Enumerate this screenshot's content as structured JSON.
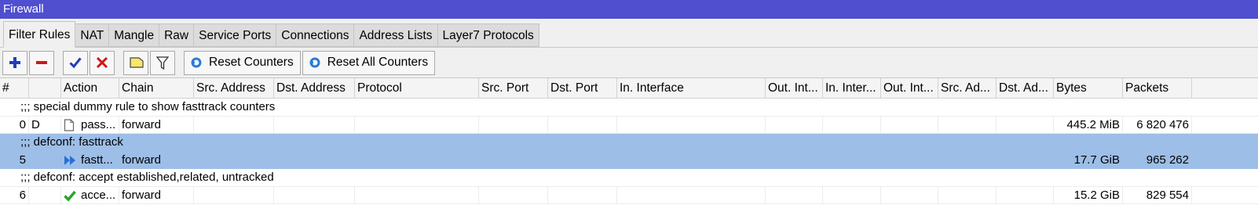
{
  "window": {
    "title": "Firewall"
  },
  "tabs": [
    {
      "label": "Filter Rules",
      "active": true
    },
    {
      "label": "NAT"
    },
    {
      "label": "Mangle"
    },
    {
      "label": "Raw"
    },
    {
      "label": "Service Ports"
    },
    {
      "label": "Connections"
    },
    {
      "label": "Address Lists"
    },
    {
      "label": "Layer7 Protocols"
    }
  ],
  "toolbar": {
    "add_icon": "plus-icon",
    "remove_icon": "minus-icon",
    "enable_icon": "check-icon",
    "disable_icon": "x-icon",
    "comment_icon": "note-icon",
    "filter_icon": "funnel-icon",
    "reset_counters_label": "Reset Counters",
    "reset_all_counters_label": "Reset All Counters"
  },
  "columns": [
    "#",
    "",
    "Action",
    "Chain",
    "Src. Address",
    "Dst. Address",
    "Protocol",
    "Src. Port",
    "Dst. Port",
    "In. Interface",
    "Out. Int...",
    "In. Inter...",
    "Out. Int...",
    "Src. Ad...",
    "Dst. Ad...",
    "Bytes",
    "Packets"
  ],
  "rows": [
    {
      "type": "comment",
      "text": ";;; special dummy rule to show fasttrack counters"
    },
    {
      "type": "rule",
      "num": "0",
      "flag": "D",
      "action_icon": "page-icon",
      "action": "pass...",
      "chain": "forward",
      "bytes": "445.2 MiB",
      "packets": "6 820 476"
    },
    {
      "type": "comment",
      "text": ";;; defconf: fasttrack",
      "selected": true
    },
    {
      "type": "rule",
      "num": "5",
      "flag": "",
      "action_icon": "fast-forward-icon",
      "action": "fastt...",
      "chain": "forward",
      "bytes": "17.7 GiB",
      "packets": "965 262",
      "selected": true
    },
    {
      "type": "comment",
      "text": ";;; defconf: accept established,related, untracked"
    },
    {
      "type": "rule",
      "num": "6",
      "flag": "",
      "action_icon": "green-check-icon",
      "action": "acce...",
      "chain": "forward",
      "bytes": "15.2 GiB",
      "packets": "829 554"
    }
  ],
  "colors": {
    "titlebar": "#4f4fcf",
    "selection": "#9dbee6"
  }
}
